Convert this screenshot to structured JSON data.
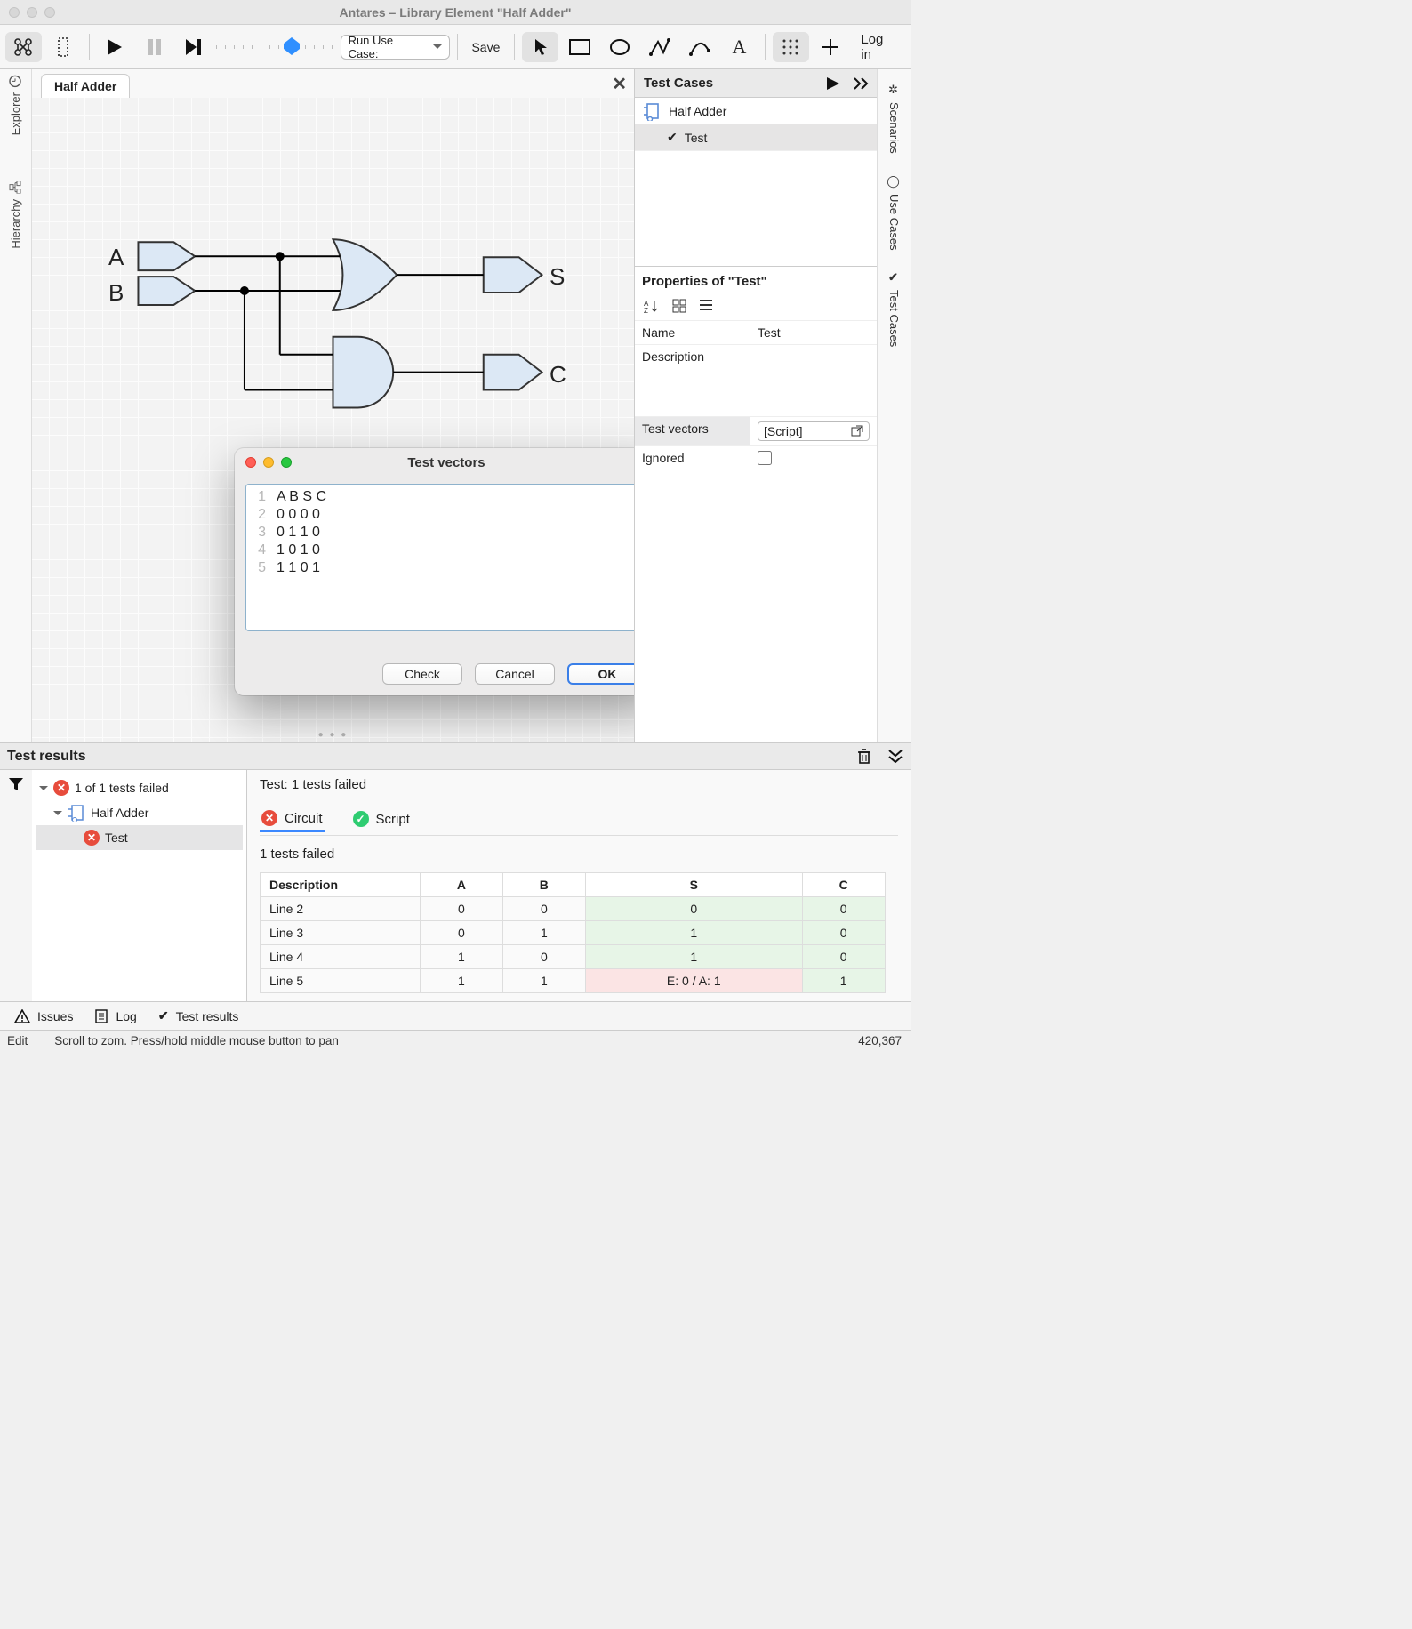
{
  "window_title": "Antares – Library Element \"Half Adder\"",
  "toolbar": {
    "run_use_case_label": "Run Use Case:",
    "save_label": "Save",
    "login_label": "Log in"
  },
  "left_sidebar": {
    "explorer_label": "Explorer",
    "hierarchy_label": "Hierarchy"
  },
  "right_sidebar": {
    "scenarios_label": "Scenarios",
    "use_cases_label": "Use Cases",
    "test_cases_label": "Test Cases"
  },
  "editor_tab": {
    "title": "Half Adder"
  },
  "circuit_labels": {
    "A": "A",
    "B": "B",
    "S": "S",
    "C": "C"
  },
  "test_cases_panel": {
    "title": "Test Cases",
    "items": [
      {
        "icon": "chip",
        "label": "Half Adder"
      },
      {
        "icon": "check",
        "label": "Test",
        "indent": true,
        "selected": true
      }
    ]
  },
  "properties": {
    "title": "Properties of \"Test\"",
    "rows": {
      "name": {
        "label": "Name",
        "value": "Test"
      },
      "description": {
        "label": "Description",
        "value": ""
      },
      "test_vectors": {
        "label": "Test vectors",
        "value": "[Script]"
      },
      "ignored": {
        "label": "Ignored",
        "checked": false
      }
    }
  },
  "dialog": {
    "title": "Test vectors",
    "lines": [
      "A B S C",
      "0 0 0 0",
      "0 1 1 0",
      "1 0 1 0",
      "1 1 0 1"
    ],
    "line_numbers": [
      "1",
      "2",
      "3",
      "4",
      "5"
    ],
    "buttons": {
      "check": "Check",
      "cancel": "Cancel",
      "ok": "OK"
    }
  },
  "results": {
    "title": "Test results",
    "tree": {
      "summary": "1 of 1 tests failed",
      "nodes": [
        {
          "label": "Half Adder",
          "icon": "chip",
          "indent": 1
        },
        {
          "label": "Test",
          "icon": "fail",
          "indent": 2,
          "selected": true
        }
      ]
    },
    "detail": {
      "header": "Test: 1 tests failed",
      "tabs": {
        "circuit": "Circuit",
        "script": "Script"
      },
      "subheader": "1 tests failed",
      "columns": [
        "Description",
        "A",
        "B",
        "S",
        "C"
      ],
      "rows": [
        {
          "cells": [
            "Line 2",
            "0",
            "0",
            "0",
            "0"
          ],
          "status": [
            "",
            "",
            "",
            "pass",
            "pass"
          ]
        },
        {
          "cells": [
            "Line 3",
            "0",
            "1",
            "1",
            "0"
          ],
          "status": [
            "",
            "",
            "",
            "pass",
            "pass"
          ]
        },
        {
          "cells": [
            "Line 4",
            "1",
            "0",
            "1",
            "0"
          ],
          "status": [
            "",
            "",
            "",
            "pass",
            "pass"
          ]
        },
        {
          "cells": [
            "Line 5",
            "1",
            "1",
            "E: 0 / A: 1",
            "1"
          ],
          "status": [
            "",
            "",
            "",
            "fail",
            "pass"
          ]
        }
      ]
    }
  },
  "footer": {
    "issues": "Issues",
    "log": "Log",
    "test_results": "Test results",
    "edit": "Edit",
    "hint": "Scroll to zom. Press/hold middle mouse button to pan",
    "coords": "420,367"
  }
}
